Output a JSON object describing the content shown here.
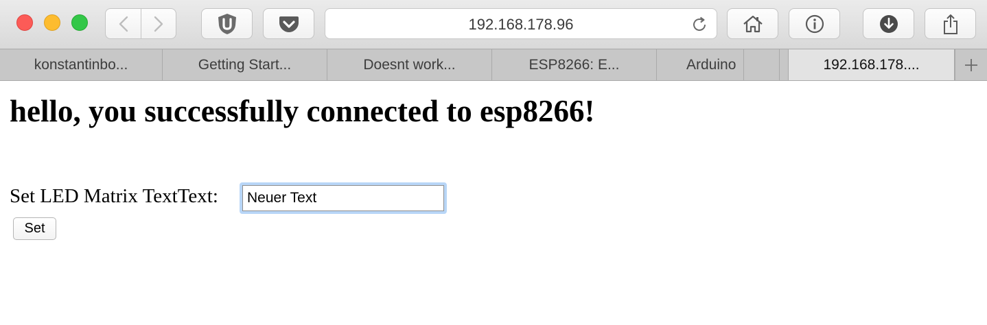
{
  "browser": {
    "address_bar": {
      "url": "192.168.178.96"
    },
    "tabs": [
      {
        "label": "konstantinbo..."
      },
      {
        "label": "Getting Start..."
      },
      {
        "label": "Doesnt work..."
      },
      {
        "label": "ESP8266: E..."
      },
      {
        "label": "Arduino"
      },
      {
        "label": "192.168.178...."
      }
    ],
    "active_tab_index": 5,
    "traffic_lights": {
      "close": "#fc5b57",
      "minimize": "#fdbc2f",
      "maximize": "#33c748"
    },
    "toolbar_icons": [
      "back-icon",
      "forward-icon",
      "ublock-icon",
      "pocket-icon",
      "reload-icon",
      "home-icon",
      "info-icon",
      "download-icon",
      "share-icon",
      "plus-icon"
    ]
  },
  "page": {
    "heading": "hello, you successfully connected to esp8266!",
    "form": {
      "label": "Set LED Matrix TextText:",
      "input_value": "Neuer Text",
      "submit_label": "Set"
    }
  }
}
